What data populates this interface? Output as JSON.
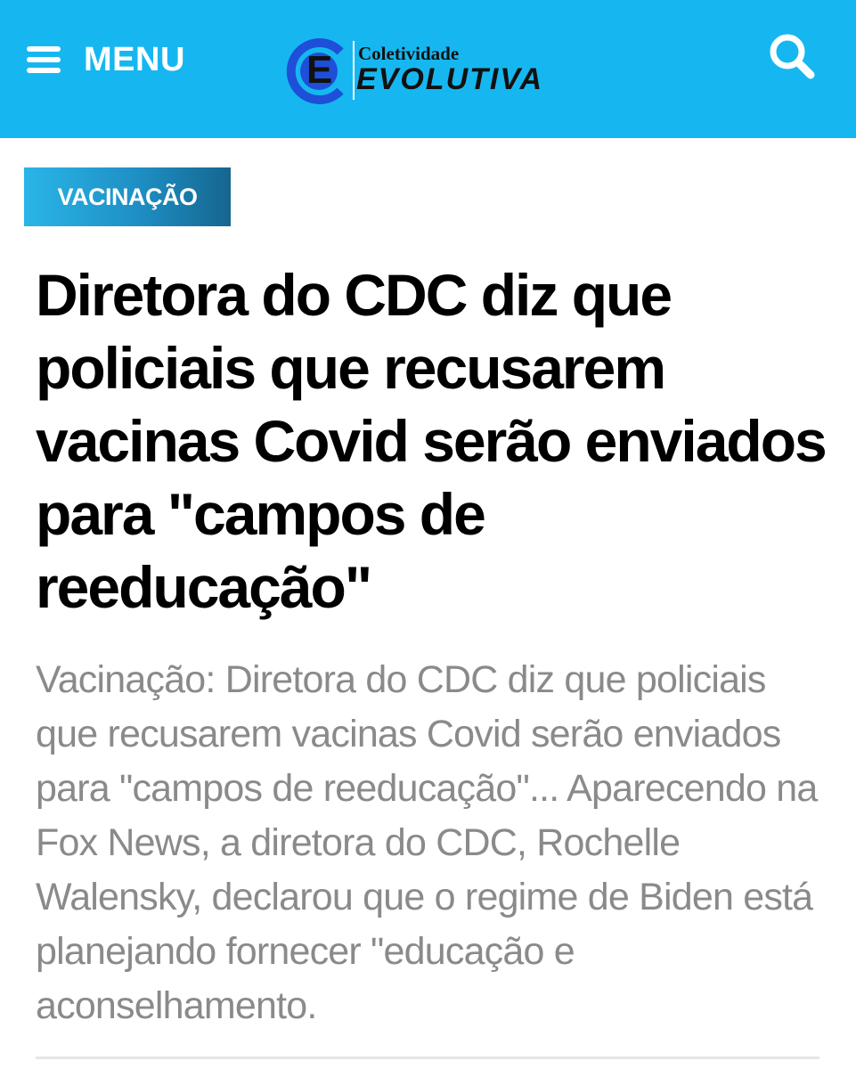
{
  "header": {
    "menu_label": "MENU",
    "menu_icon": "hamburger-icon",
    "search_icon": "search-icon",
    "background_color": "#16b7f0",
    "logo": {
      "small_text": "Coletividade",
      "big_text": "EVOLUTIVA",
      "monogram": "E"
    }
  },
  "article": {
    "category": "VACINAÇÃO",
    "title": "Diretora do CDC diz que policiais que recusarem vacinas Covid serão enviados para \"campos de reeducação\"",
    "excerpt": "Vacinação: Diretora do CDC diz que policiais que recusarem vacinas Covid serão enviados para \"campos de reeducação\"... Aparecendo na Fox News, a diretora do CDC, Rochelle Walensky, declarou que o regime de Biden está planejando fornecer \"educação e aconselhamento."
  },
  "colors": {
    "accent": "#16b7f0",
    "badge_dark": "#15668f",
    "excerpt_text": "#8a8a8a"
  }
}
